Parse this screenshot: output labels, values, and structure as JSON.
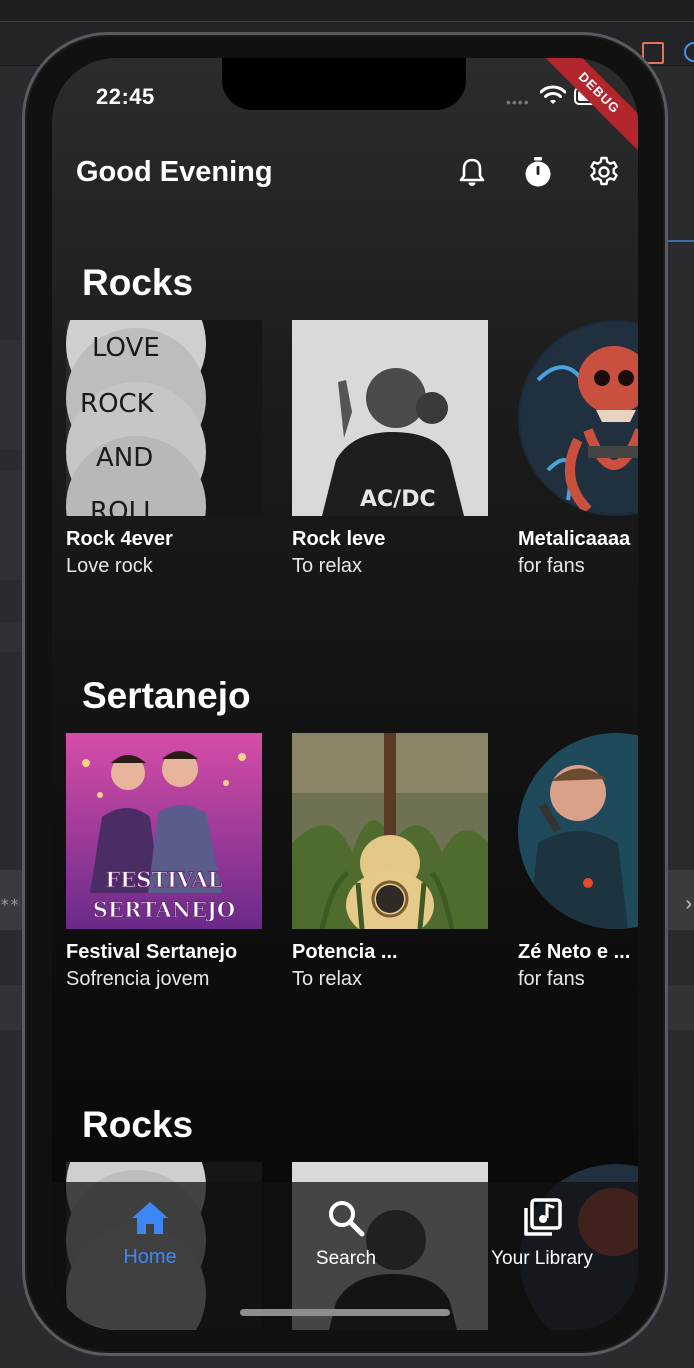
{
  "status_bar": {
    "time": "22:45",
    "debug_label": "DEBUG"
  },
  "header": {
    "greeting": "Good Evening"
  },
  "sections": [
    {
      "title": "Rocks",
      "cards": [
        {
          "title": "Rock 4ever",
          "subtitle": "Love rock",
          "art_text": [
            "LOVE",
            "ROCK",
            "AND",
            "ROLL"
          ]
        },
        {
          "title": "Rock leve",
          "subtitle": "To relax",
          "art_text": [
            "AC/DC"
          ]
        },
        {
          "title": "Metalicaaaa",
          "subtitle": "for fans"
        }
      ]
    },
    {
      "title": "Sertanejo",
      "cards": [
        {
          "title": "Festival Sertanejo",
          "subtitle": "Sofrencia jovem",
          "art_text": [
            "FESTIVAL",
            "SERTANEJO"
          ]
        },
        {
          "title": "Potencia ...",
          "subtitle": "To relax"
        },
        {
          "title": "Zé Neto e ...",
          "subtitle": "for fans"
        }
      ]
    },
    {
      "title": "Rocks"
    }
  ],
  "bottom_nav": [
    {
      "label": "Home",
      "icon": "home-icon",
      "active": true
    },
    {
      "label": "Search",
      "icon": "search-icon",
      "active": false
    },
    {
      "label": "Your Library",
      "icon": "library-icon",
      "active": false
    }
  ],
  "colors": {
    "accent": "#3d87f5",
    "debug_ribbon": "#b3262e",
    "background": "#121212"
  }
}
